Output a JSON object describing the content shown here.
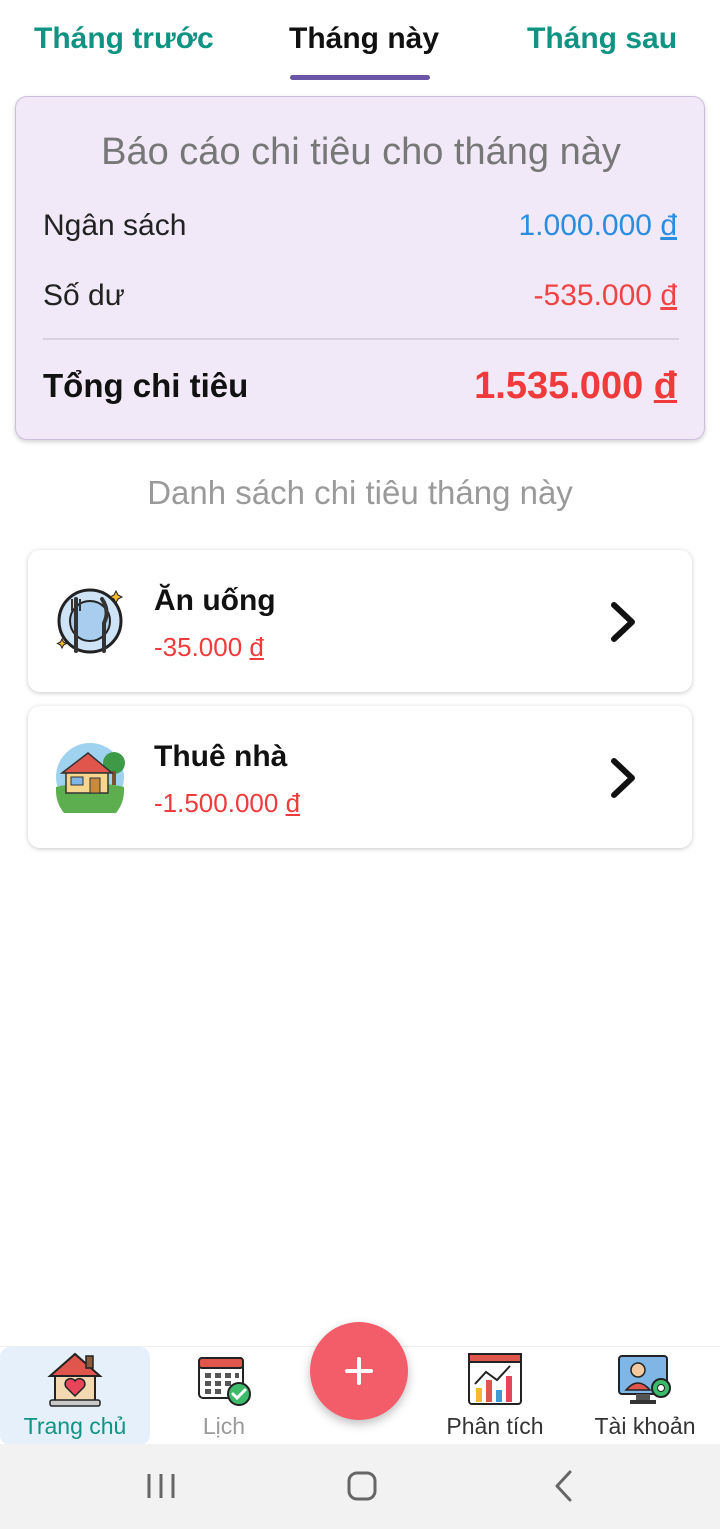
{
  "tabs": {
    "prev": "Tháng trước",
    "current": "Tháng này",
    "next": "Tháng sau"
  },
  "report": {
    "title": "Báo cáo chi tiêu cho tháng này",
    "budget_label": "Ngân sách",
    "budget_value": "1.000.000",
    "balance_label": "Số dư",
    "balance_value": "-535.000",
    "total_label": "Tổng chi tiêu",
    "total_value": "1.535.000",
    "currency": "đ"
  },
  "list_title": "Danh sách chi tiêu tháng này",
  "items": [
    {
      "name": "Ăn uống",
      "amount": "-35.000",
      "currency": "đ",
      "icon": "food-plate-icon"
    },
    {
      "name": "Thuê nhà",
      "amount": "-1.500.000",
      "currency": "đ",
      "icon": "house-rent-icon"
    }
  ],
  "nav": {
    "home": "Trang chủ",
    "calendar": "Lịch",
    "analytics": "Phân tích",
    "account": "Tài khoản"
  },
  "colors": {
    "accent_teal": "#0f9483",
    "tab_indicator": "#6a55a8",
    "card_bg": "#f1e9f7",
    "budget_blue": "#2b8de0",
    "negative_red": "#ef3b3b",
    "fab": "#f35d6a"
  }
}
